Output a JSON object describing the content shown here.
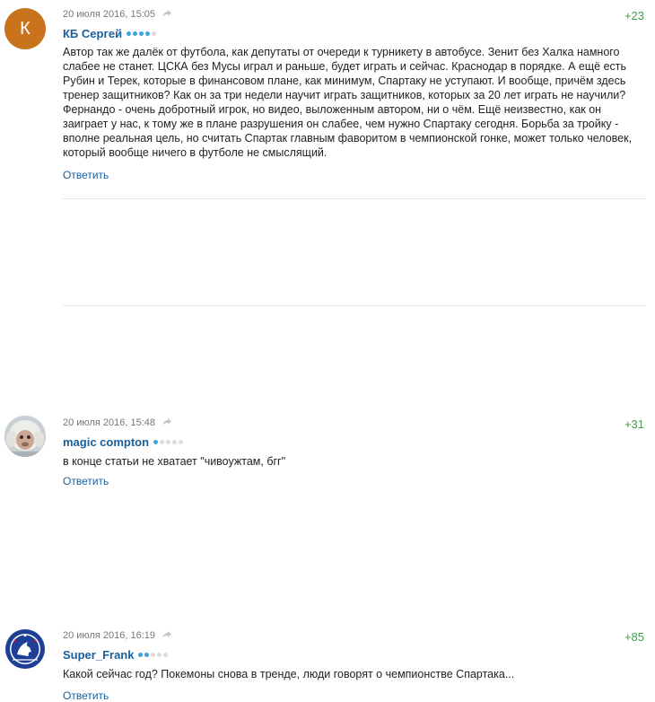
{
  "comments": [
    {
      "avatar_letter": "К",
      "date": "20 июля 2016, 15:05",
      "author": "КБ Сергей",
      "rating_dots": 4,
      "score": "+23",
      "text": "Автор так же далёк от футбола, как депутаты от очереди к турникету в автобусе. Зенит без Халка намного слабее не станет. ЦСКА без Мусы играл и раньше, будет играть и сейчас. Краснодар в порядке. А ещё есть Рубин и Терек, которые в финансовом плане, как минимум, Спартаку не уступают. И вообще, причём здесь тренер защитников? Как он за три недели научит играть защитников, которых за 20 лет играть не научили? Фернандо - очень добротный игрок, но видео, выложенным автором, ни о чём. Ещё неизвестно, как он заиграет у нас, к тому же в плане разрушения он слабее, чем нужно Спартаку сегодня. Борьба за тройку - вполне реальная цель, но считать Спартак главным фаворитом в чемпионской гонке, может только человек, который вообще ничего в футболе не смыслящий.",
      "reply_label": "Ответить",
      "avatar_icon": "letter-avatar"
    },
    {
      "date": "20 июля 2016, 15:48",
      "author": "magic compton",
      "rating_dots": 1,
      "score": "+31",
      "text": "в конце статьи не хватает \"чивоужтам, бгг\"",
      "reply_label": "Ответить",
      "avatar_icon": "monkey-photo-avatar"
    },
    {
      "date": "20 июля 2016, 16:19",
      "author": "Super_Frank",
      "rating_dots": 2,
      "score": "+85",
      "text": "Какой сейчас год? Покемоны снова в тренде, люди говорят о чемпионстве Спартака...",
      "reply_label": "Ответить",
      "avatar_icon": "chelsea-crest-avatar"
    }
  ],
  "colors": {
    "author": "#1a5e9a",
    "score": "#3e9f45",
    "rating_dot_on": "#3da4e0",
    "rating_dot_off": "#dcdcdc",
    "letter_avatar_bg": "#c9731d"
  }
}
